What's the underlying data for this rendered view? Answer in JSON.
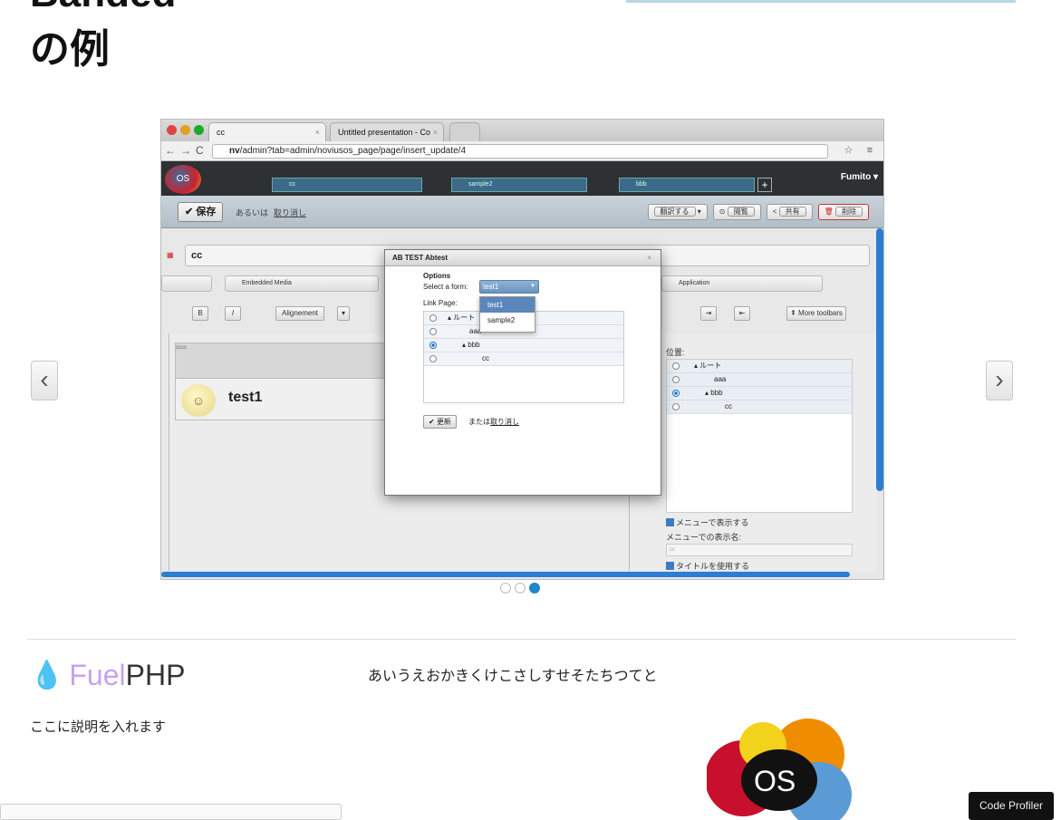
{
  "page": {
    "title_line1": "Banded",
    "title_line2": "の例"
  },
  "browser": {
    "tab1": "cc",
    "tab2": "Untitled presentation - Co",
    "url_host": "nv",
    "url_path": "/admin?tab=admin/noviusos_page/page/insert_update/4"
  },
  "app": {
    "user": "Fumito",
    "page_tabs": [
      "cc",
      "sample2",
      "bbb"
    ],
    "save_label": "保存",
    "or_label": "あるいは",
    "cancel_label": "取り消し",
    "translate_label": "翻訳する",
    "view_label": "閲覧",
    "share_label": "共有",
    "delete_label": "削除",
    "title_value": "cc",
    "embedded_media": "Embedded Media",
    "application": "Application",
    "alignment": "Alignement",
    "more_toolbars": "More toolbars",
    "bold": "B",
    "italic": "I",
    "editor_label": "cccc",
    "widget_text": "test1",
    "position_label": "位置:",
    "tree": [
      {
        "label": "ルート",
        "selected": false
      },
      {
        "label": "aaa",
        "selected": false
      },
      {
        "label": "bbb",
        "selected": true
      },
      {
        "label": "cc",
        "selected": false
      }
    ],
    "show_in_menu": "メニューで表示する",
    "menu_name_label": "メニューでの表示名:",
    "menu_name_placeholder": "cc",
    "use_title": "タイトルを使用する"
  },
  "modal": {
    "title": "AB TEST Abtest",
    "options_label": "Options",
    "select_label": "Select a form:",
    "selected_form": "test1",
    "form_options": [
      "test1",
      "sample2"
    ],
    "link_page_label": "Link Page:",
    "tree": [
      {
        "label": "ルート",
        "selected": false
      },
      {
        "label": "aaa",
        "selected": false
      },
      {
        "label": "bbb",
        "selected": true
      },
      {
        "label": "cc",
        "selected": false
      }
    ],
    "update_label": "更新",
    "or_label": "または",
    "cancel_label": "取り消し"
  },
  "carousel": {
    "total_slides": 3,
    "active_slide": 3
  },
  "footer": {
    "logo_fuel": "Fuel",
    "logo_php": "PHP",
    "description": "ここに説明を入れます",
    "kana_text": "あいうえおかきくけこさしすせそたちつてと",
    "os_logo_text": "OS",
    "code_profiler": "Code Profiler"
  },
  "colors": {
    "accent": "#1d87c8",
    "modal_select": "#6a93bf",
    "danger": "#cc2222"
  }
}
